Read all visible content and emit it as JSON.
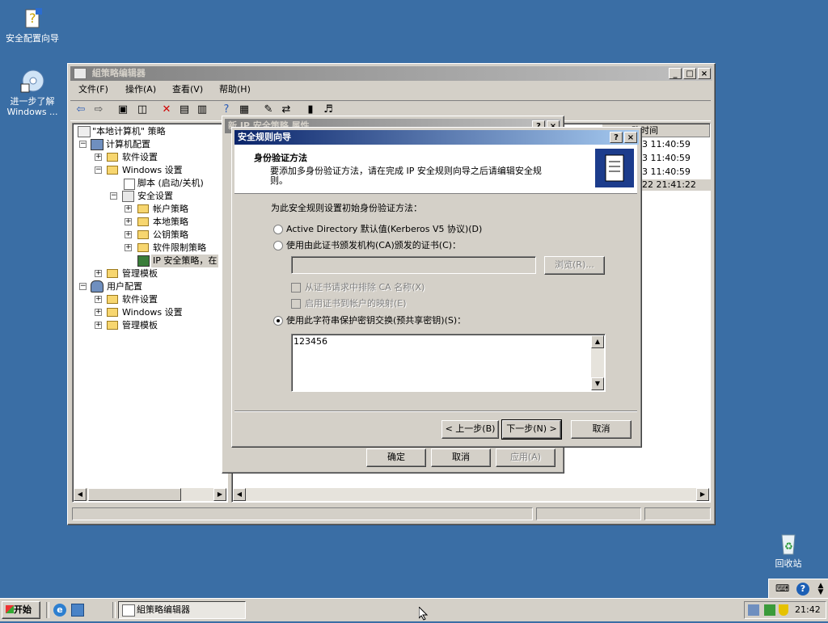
{
  "desktop": {
    "icons": [
      {
        "label": "安全配置向导"
      },
      {
        "label1": "进一步了解",
        "label2": "Windows ..."
      },
      {
        "label": "回收站"
      }
    ]
  },
  "gpedit": {
    "title": "組策略编辑器",
    "menu": [
      "文件(F)",
      "操作(A)",
      "查看(V)",
      "帮助(H)"
    ],
    "tree": [
      {
        "label": "\"本地计算机\" 策略"
      },
      {
        "label": "计算机配置"
      },
      {
        "label": "软件设置"
      },
      {
        "label": "Windows 设置"
      },
      {
        "label": "脚本 (启动/关机)"
      },
      {
        "label": "安全设置"
      },
      {
        "label": "帐户策略"
      },
      {
        "label": "本地策略"
      },
      {
        "label": "公钥策略"
      },
      {
        "label": "软件限制策略"
      },
      {
        "label": "IP 安全策略，在"
      },
      {
        "label": "管理模板"
      },
      {
        "label": "用户配置"
      },
      {
        "label": "软件设置"
      },
      {
        "label": "Windows 设置"
      },
      {
        "label": "管理模板"
      }
    ],
    "list": {
      "column_header": "改时间",
      "rows": [
        "3 11:40:59",
        "3 11:40:59",
        "3 11:40:59",
        "22 21:41:22"
      ]
    }
  },
  "props_dialog": {
    "title": "新 IP 安全策略 属性",
    "ok": "确定",
    "cancel": "取消",
    "apply": "应用(A)"
  },
  "wizard": {
    "title": "安全规则向导",
    "header_title": "身份验证方法",
    "header_desc_1": "要添加多身份验证方法，请在完成 IP 安全规则向导之后请编辑安全规",
    "header_desc_2": "则。",
    "prompt": "为此安全规则设置初始身份验证方法：",
    "opt_ad": "Active Directory 默认值(Kerberos V5 协议)(D)",
    "opt_cert": "使用由此证书颁发机构(CA)颁发的证书(C)：",
    "browse": "浏览(R)...",
    "chk_exclude": "从证书请求中排除 CA 名称(X)",
    "chk_map": "启用证书到帐户的映射(E)",
    "opt_psk": "使用此字符串保护密钥交换(预共享密钥)(S)：",
    "psk_value": "123456",
    "back": "< 上一步(B)",
    "next": "下一步(N) >",
    "cancel": "取消"
  },
  "taskbar": {
    "start": "开始",
    "task": "組策略编辑器",
    "clock": "21:42"
  }
}
